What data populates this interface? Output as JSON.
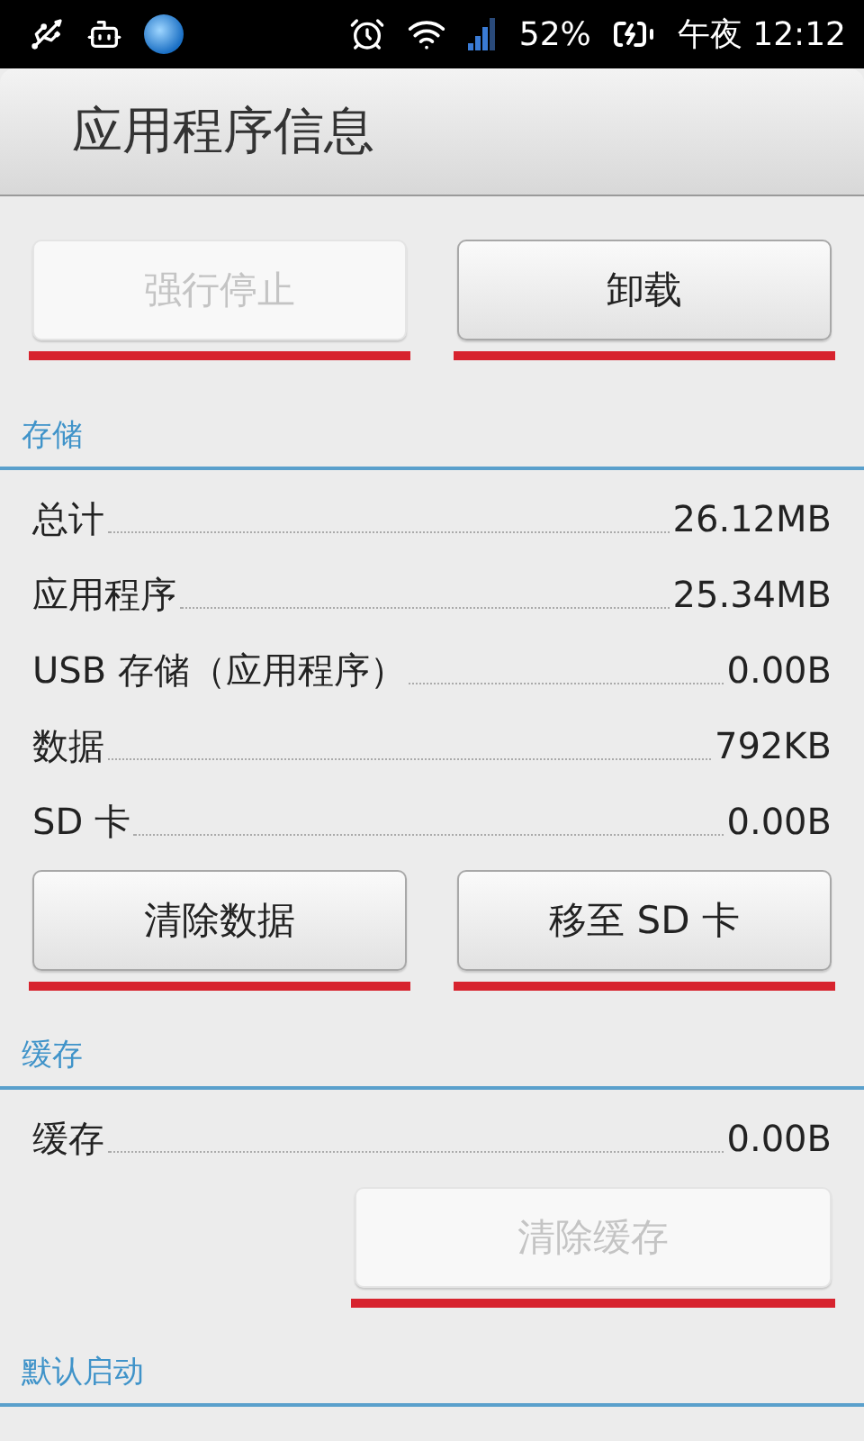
{
  "status_bar": {
    "battery_percent": "52%",
    "time": "午夜 12:12"
  },
  "title": "应用程序信息",
  "top_buttons": [
    {
      "label": "强行停止",
      "disabled": true,
      "underlined": true
    },
    {
      "label": "卸载",
      "disabled": false,
      "underlined": true
    }
  ],
  "sections": [
    {
      "header": "存储",
      "rows": [
        {
          "label": "总计",
          "value": "26.12MB"
        },
        {
          "label": "应用程序",
          "value": "25.34MB"
        },
        {
          "label": "USB 存储（应用程序）",
          "value": "0.00B"
        },
        {
          "label": "数据",
          "value": "792KB"
        },
        {
          "label": "SD 卡",
          "value": "0.00B"
        }
      ],
      "buttons": [
        {
          "label": "清除数据",
          "disabled": false,
          "underlined": true
        },
        {
          "label": "移至 SD 卡",
          "disabled": false,
          "underlined": true
        }
      ]
    },
    {
      "header": "缓存",
      "rows": [
        {
          "label": "缓存",
          "value": "0.00B"
        }
      ],
      "buttons": [
        {
          "label": "清除缓存",
          "disabled": true,
          "underlined": true
        }
      ]
    },
    {
      "header": "默认启动"
    }
  ]
}
